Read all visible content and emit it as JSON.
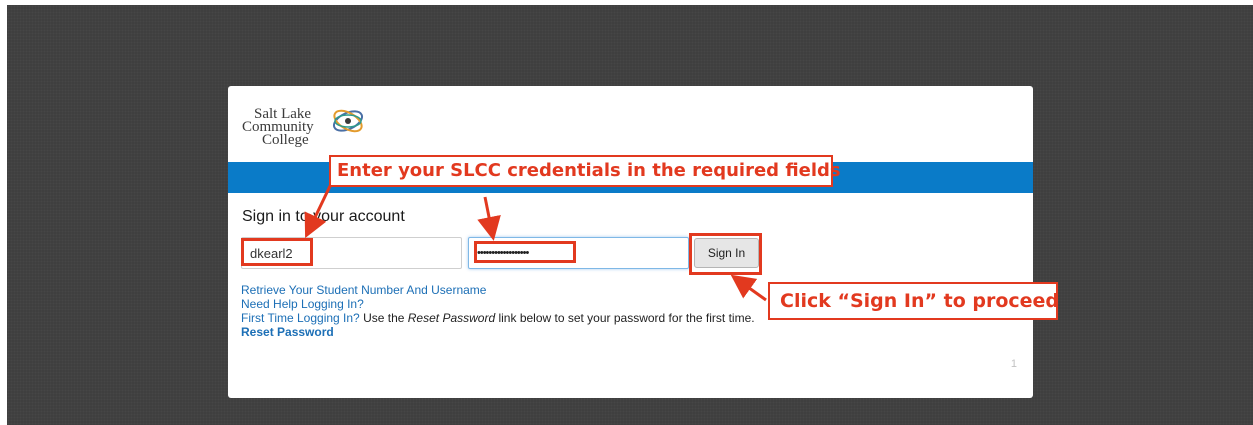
{
  "logo": {
    "line1": "Salt Lake",
    "line2": "Community",
    "line3": "College"
  },
  "form": {
    "heading": "Sign in to your account",
    "username_value": "dkearl2",
    "password_value": "••••••••••••••••••",
    "signin_label": "Sign In"
  },
  "links": {
    "retrieve": "Retrieve Your Student Number And Username",
    "need_help": "Need Help Logging In?",
    "first_time": "First Time Logging In?",
    "first_time_text_1": " Use the ",
    "first_time_text_em": "Reset Password",
    "first_time_text_2": " link below to set your password for the first time.",
    "reset": "Reset Password"
  },
  "page_number": "1",
  "annotations": {
    "enter_credentials": "Enter your SLCC credentials in the required fields",
    "click_signin": "Click “Sign In” to proceed"
  },
  "colors": {
    "accent_blue": "#0a7bc8",
    "annotation_red": "#e2391f",
    "link_blue": "#1c6fb6"
  }
}
